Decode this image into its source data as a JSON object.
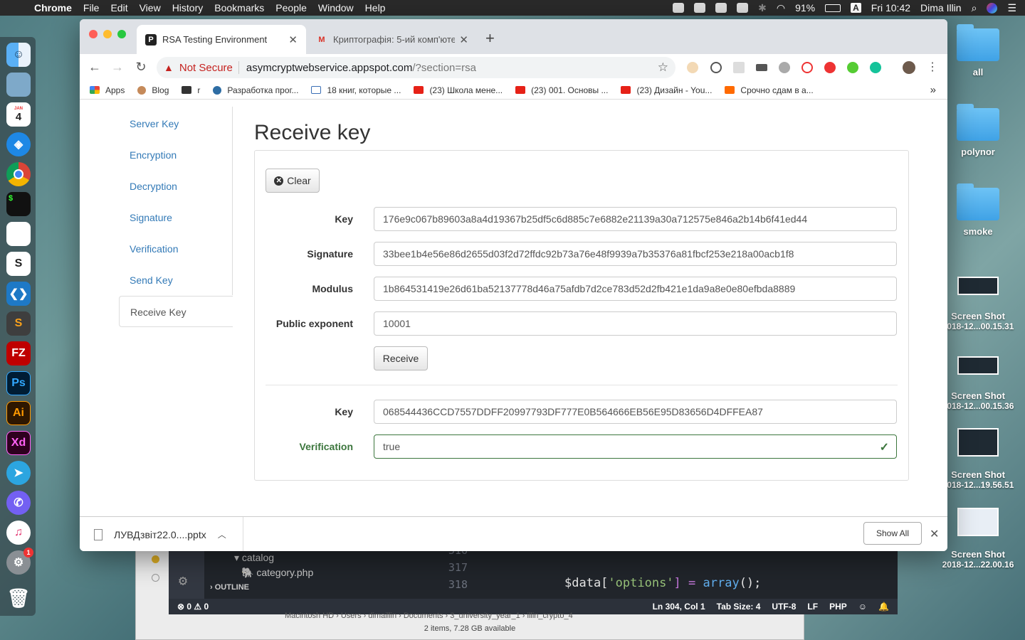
{
  "menubar": {
    "app_name": "Chrome",
    "menus": [
      "File",
      "Edit",
      "View",
      "History",
      "Bookmarks",
      "People",
      "Window",
      "Help"
    ],
    "battery": "91%",
    "input_source": "A",
    "clock": "Fri 10:42",
    "user": "Dima Illin"
  },
  "dock": {
    "calendar_month": "JAN",
    "calendar_day": "4",
    "items": [
      "Finder",
      "Preview",
      "Calendar",
      "Safari",
      "Chrome",
      "Terminal",
      "Reminders",
      "Slack",
      "VS Code",
      "Sublime Text",
      "FileZilla",
      "Photoshop",
      "Illustrator",
      "XD",
      "Telegram",
      "Viber",
      "iTunes",
      "System Preferences",
      "Trash"
    ],
    "labels": {
      "photoshop": "Ps",
      "illustrator": "Ai",
      "xd": "Xd",
      "sublime": "S",
      "filezilla": "FZ",
      "slack": "S"
    },
    "sysprefs_badge": "1"
  },
  "desktop": {
    "folders": [
      "all",
      "polynor",
      "smoke"
    ],
    "screenshots": [
      {
        "title": "Screen Shot",
        "sub": "2018-12...00.15.31"
      },
      {
        "title": "Screen Shot",
        "sub": "2018-12...00.15.36"
      },
      {
        "title": "Screen Shot",
        "sub": "2018-12...19.56.51"
      },
      {
        "title": "Screen Shot",
        "sub": "2018-12...22.00.16"
      }
    ]
  },
  "background_apps": {
    "vscode": {
      "tree": [
        "catalog",
        "category.php",
        "OUTLINE"
      ],
      "line_numbers": [
        "316",
        "317",
        "318"
      ],
      "code_line": {
        "var": "$data[",
        "str": "'options'",
        "rest": "] = ",
        "fn": "array",
        "end": "();"
      },
      "status_left": "⊗ 0 ⚠ 0",
      "status_items": [
        "Ln 304, Col 1",
        "Tab Size: 4",
        "UTF-8",
        "LF",
        "PHP"
      ]
    },
    "finder_path": "Macintosh HD › Users › dimaillin › Documents › 3_university_year_1 › illin_crypto_4",
    "finder_status": "2 items, 7.28 GB available"
  },
  "browser": {
    "tabs": [
      {
        "title": "RSA Testing Environment",
        "favicon": "P"
      },
      {
        "title": "Криптографія: 5-ий комп'юте",
        "favicon": "M"
      }
    ],
    "new_tab": "+",
    "security": "Not Secure",
    "url_host": "asymcryptwebservice.appspot.com",
    "url_path": "/?section=rsa",
    "bookmarks": [
      {
        "label": "Apps",
        "color": "#e8453c"
      },
      {
        "label": "Blog",
        "color": "#c58a5a"
      },
      {
        "label": "r",
        "color": "#333333"
      },
      {
        "label": "Разработка прог...",
        "color": "#2e6da4"
      },
      {
        "label": "18 книг, которые ...",
        "color": "#3b6fb6"
      },
      {
        "label": "(23) Школа мене...",
        "color": "#e62117"
      },
      {
        "label": "(23) 001. Основы ...",
        "color": "#e62117"
      },
      {
        "label": "(23) Дизайн - You...",
        "color": "#e62117"
      },
      {
        "label": "Срочно сдам в а...",
        "color": "#ff6a00"
      }
    ],
    "bookmarks_more": "»"
  },
  "page": {
    "nav": [
      {
        "label": "Server Key"
      },
      {
        "label": "Encryption"
      },
      {
        "label": "Decryption"
      },
      {
        "label": "Signature"
      },
      {
        "label": "Verification"
      },
      {
        "label": "Send Key"
      },
      {
        "label": "Receive Key"
      }
    ],
    "heading": "Receive key",
    "clear_button": "Clear",
    "form": {
      "key_label": "Key",
      "key_value": "176e9c067b89603a8a4d19367b25df5c6d885c7e6882e21139a30a712575e846a2b14b6f41ed44",
      "signature_label": "Signature",
      "signature_value": "33bee1b4e56e86d2655d03f2d72ffdc92b73a76e48f9939a7b35376a81fbcf253e218a00acb1f8",
      "modulus_label": "Modulus",
      "modulus_value": "1b864531419e26d61ba52137778d46a75afdb7d2ce783d52d2fb421e1da9a8e0e80efbda8889",
      "exponent_label": "Public exponent",
      "exponent_value": "10001",
      "receive_button": "Receive"
    },
    "result": {
      "key_label": "Key",
      "key_value": "068544436CCD7557DDFF20997793DF777E0B564666EB56E95D83656D4DFFEA87",
      "verification_label": "Verification",
      "verification_value": "true",
      "success_color": "#3c763d"
    }
  },
  "downloads": {
    "file": "ЛУВДзвіт22.0....pptx",
    "show_all": "Show All"
  }
}
